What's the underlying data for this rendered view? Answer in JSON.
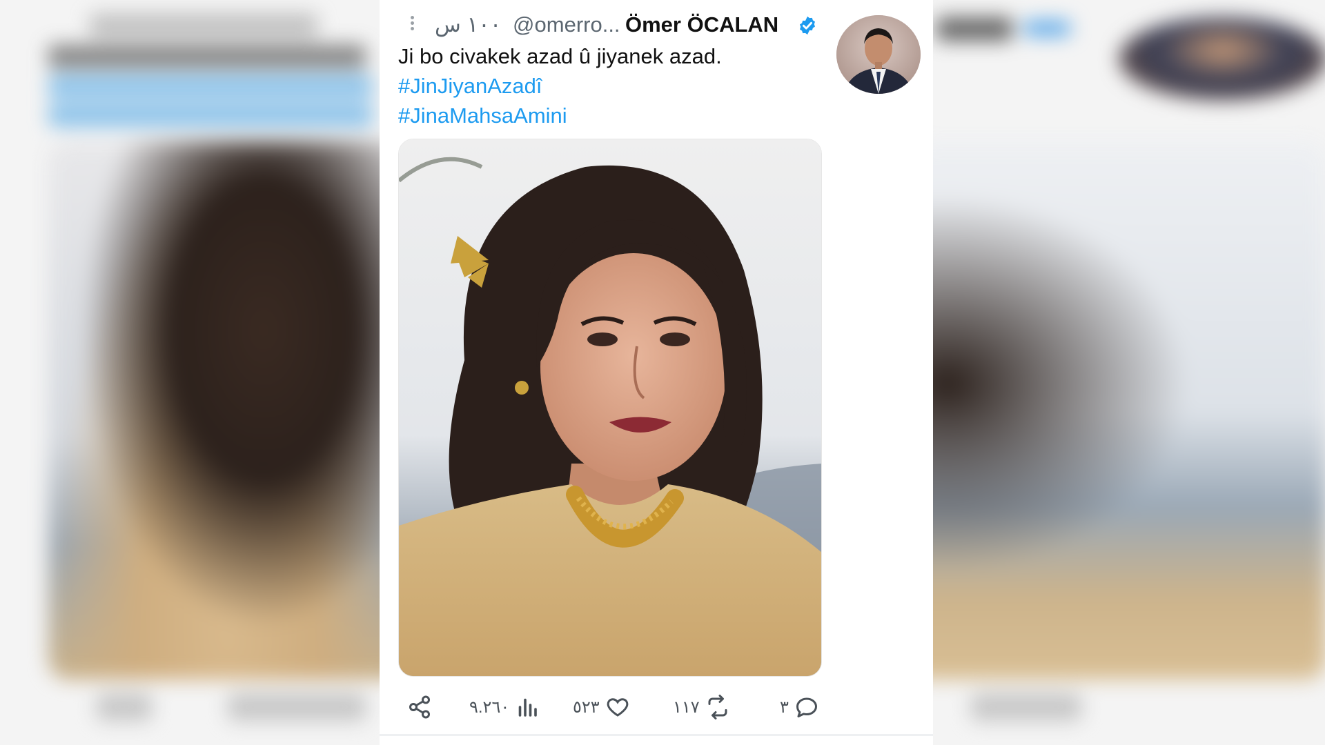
{
  "tweet": {
    "author_name": "Ömer ÖCALAN",
    "handle": "@omerro...",
    "time": "١٠٠ س",
    "text": "Ji bo civakek azad û jiyanek azad.",
    "hashtags": [
      "#JinJiyanAzadî",
      "#JinaMahsaAmini"
    ]
  },
  "actions": {
    "views": "٩.٢٦٠",
    "likes": "٥٢٣",
    "retweets": "١١٧",
    "replies": "٣"
  },
  "colors": {
    "link": "#1d9bf0",
    "verified": "#1d9bf0",
    "icon": "#4a5158"
  },
  "icons": [
    "more-vertical-icon",
    "verified-badge-icon",
    "share-icon",
    "views-bar-icon",
    "heart-icon",
    "retweet-icon",
    "reply-icon"
  ]
}
